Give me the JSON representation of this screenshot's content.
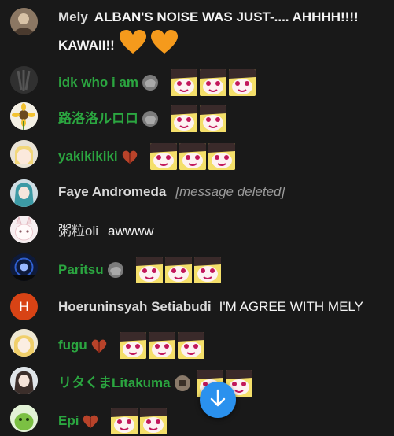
{
  "messages": [
    {
      "author": "Mely",
      "text_line1": "ALBAN'S NOISE WAS JUST-.... AHHHH!!!!",
      "text_line2": "KAWAII!!",
      "emoji": "orange-heart"
    },
    {
      "author": "idk who i am",
      "badge": "member-badge",
      "emote_count": 3
    },
    {
      "author": "路洛洛ルロロ",
      "badge": "member-badge",
      "emote_count": 2
    },
    {
      "author": "yakikikiki",
      "badge": "member-badge",
      "emote_count": 3
    },
    {
      "author": "Faye Andromeda",
      "deleted": "[message deleted]"
    },
    {
      "author": "粥粒oli",
      "text": "awwww"
    },
    {
      "author": "Paritsu",
      "badge": "member-badge",
      "emote_count": 3
    },
    {
      "author": "Hoeruninsyah Setiabudi",
      "avatar_letter": "H",
      "text": "I'M AGREE WITH MELY"
    },
    {
      "author": "fugu",
      "badge": "member-badge",
      "emote_count": 3
    },
    {
      "author": "リタくまLitakuma",
      "badge": "member-badge",
      "emote_count": 2
    },
    {
      "author": "Epi",
      "badge": "member-badge",
      "emote_count": 2
    }
  ],
  "colors": {
    "background": "#191919",
    "member_name": "#2ba640",
    "plain_name": "#dadada",
    "scroll_button": "#2a91ee",
    "avatar_h": "#d84315"
  },
  "scroll_button_icon": "arrow-down-icon"
}
